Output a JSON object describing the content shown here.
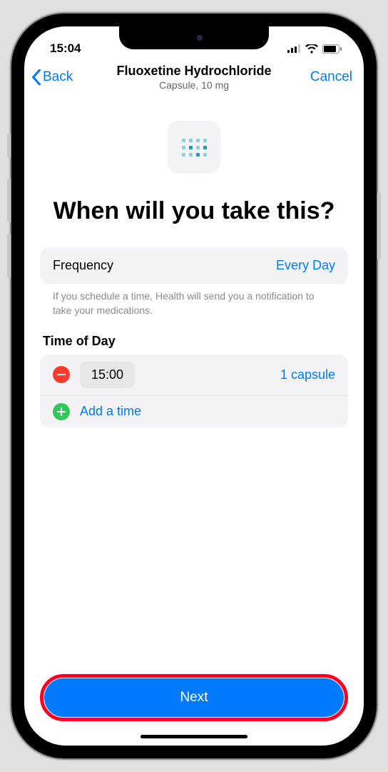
{
  "status": {
    "time": "15:04"
  },
  "nav": {
    "back": "Back",
    "title": "Fluoxetine Hydrochloride",
    "subtitle": "Capsule, 10 mg",
    "cancel": "Cancel"
  },
  "main": {
    "headline": "When will you take this?",
    "frequency": {
      "label": "Frequency",
      "value": "Every Day"
    },
    "helper": "If you schedule a time, Health will send you a notification to take your medications.",
    "time_section_label": "Time of Day",
    "times": [
      {
        "time": "15:00",
        "dose": "1 capsule"
      }
    ],
    "add_time": "Add a time",
    "next": "Next"
  }
}
